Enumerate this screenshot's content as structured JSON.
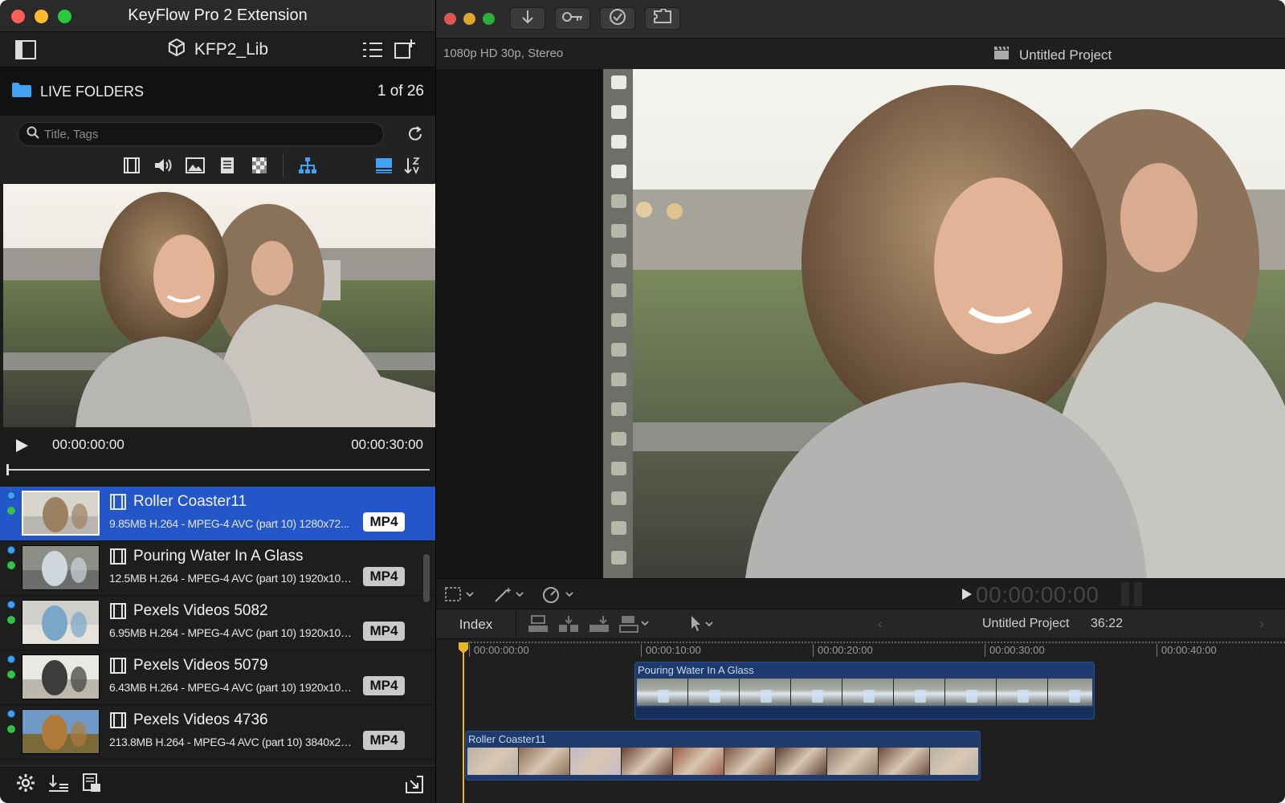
{
  "keyflow": {
    "window_title": "KeyFlow Pro 2 Extension",
    "library_name": "KFP2_Lib",
    "folder_label": "LIVE FOLDERS",
    "folder_count": "1 of 26",
    "search_placeholder": "Title, Tags",
    "filter_icons": [
      "film-icon",
      "audio-icon",
      "image-icon",
      "document-icon",
      "checker-icon",
      "hierarchy-icon",
      "list-view-icon",
      "sort-icon"
    ],
    "preview": {
      "timecode_start": "00:00:00:00",
      "timecode_end": "00:00:30:00"
    },
    "clips": [
      {
        "title": "Roller Coaster11",
        "meta": "9.85MB H.264 - MPEG-4 AVC (part 10) 1280x72...",
        "format": "MP4",
        "selected": true
      },
      {
        "title": "Pouring Water In A Glass",
        "meta": "12.5MB H.264 - MPEG-4 AVC (part 10) 1920x108...",
        "format": "MP4",
        "selected": false
      },
      {
        "title": "Pexels Videos 5082",
        "meta": "6.95MB H.264 - MPEG-4 AVC (part 10) 1920x108...",
        "format": "MP4",
        "selected": false
      },
      {
        "title": "Pexels Videos 5079",
        "meta": "6.43MB H.264 - MPEG-4 AVC (part 10) 1920x108...",
        "format": "MP4",
        "selected": false
      },
      {
        "title": "Pexels Videos 4736",
        "meta": "213.8MB H.264 - MPEG-4 AVC (part 10) 3840x21...",
        "format": "MP4",
        "selected": false
      }
    ],
    "colors": {
      "selection": "#2357c9",
      "dot_blue": "#3ea0ff",
      "dot_green": "#31c24a"
    }
  },
  "fcp": {
    "format_info": "1080p HD 30p, Stereo",
    "project_title": "Untitled Project",
    "viewer_timecode": "00:00:00:00",
    "index_label": "Index",
    "timeline_project": "Untitled Project",
    "timeline_duration": "36:22",
    "ruler_labels": [
      "00:00:00:00",
      "00:00:10:00",
      "00:00:20:00",
      "00:00:30:00",
      "00:00:40:00"
    ],
    "clips": [
      {
        "name": "Pouring Water In A Glass"
      },
      {
        "name": "Roller Coaster11"
      }
    ],
    "colors": {
      "playhead": "#e8b81f",
      "clip": "#1f3a6c"
    }
  }
}
